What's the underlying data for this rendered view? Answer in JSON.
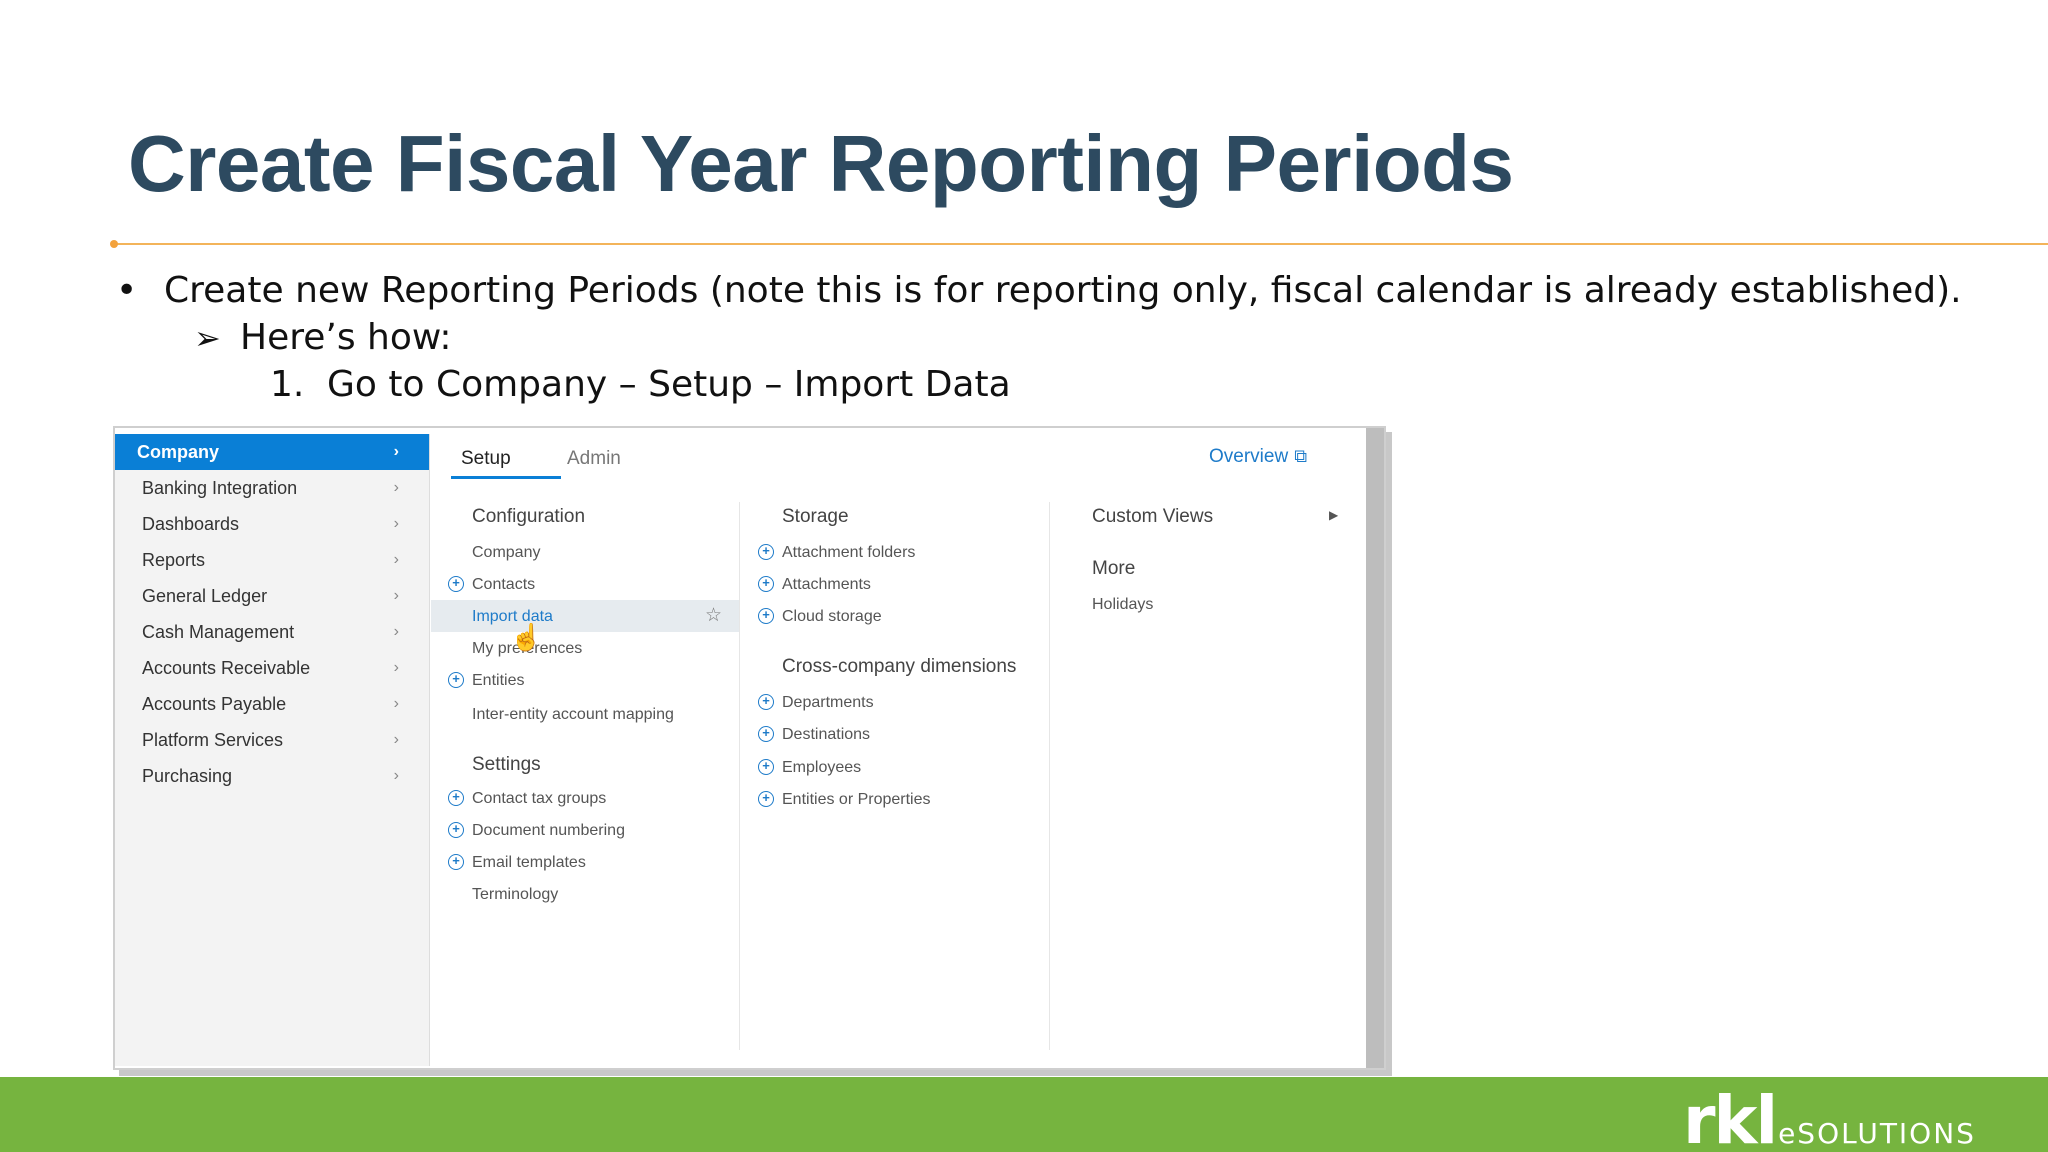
{
  "slide": {
    "title": "Create Fiscal Year Reporting Periods",
    "bullet_1": "Create new Reporting Periods (note this is for reporting only, fiscal calendar is already established).",
    "bullet_2": "Here’s how:",
    "step_1_number": "1.",
    "step_1": "Go to Company – Setup – Import Data"
  },
  "sidebar": {
    "items": [
      {
        "label": "Company"
      },
      {
        "label": "Banking Integration"
      },
      {
        "label": "Dashboards"
      },
      {
        "label": "Reports"
      },
      {
        "label": "General Ledger"
      },
      {
        "label": "Cash Management"
      },
      {
        "label": "Accounts Receivable"
      },
      {
        "label": "Accounts Payable"
      },
      {
        "label": "Platform Services"
      },
      {
        "label": "Purchasing"
      }
    ]
  },
  "tabs": {
    "setup": "Setup",
    "admin": "Admin",
    "overview": "Overview"
  },
  "configuration": {
    "title": "Configuration",
    "items": [
      "Company",
      "Contacts",
      "Import data",
      "My preferences",
      "Entities",
      "Inter-entity account mapping"
    ]
  },
  "settings": {
    "title": "Settings",
    "items": [
      "Contact tax groups",
      "Document numbering",
      "Email templates",
      "Terminology"
    ]
  },
  "storage": {
    "title": "Storage",
    "items": [
      "Attachment folders",
      "Attachments",
      "Cloud storage"
    ]
  },
  "cross_company": {
    "title": "Cross-company dimensions",
    "items": [
      "Departments",
      "Destinations",
      "Employees",
      "Entities or Properties"
    ]
  },
  "custom_views": {
    "title": "Custom Views"
  },
  "more": {
    "title": "More",
    "items": [
      "Holidays"
    ]
  },
  "logo": {
    "rkl": "rkl",
    "solutions": "eSOLUTIONS"
  },
  "colors": {
    "title": "#2d4a60",
    "accent_line": "#f3b45a",
    "active_nav": "#0a7fd6",
    "link": "#1e7bc9",
    "footer": "#76b43f"
  },
  "icons": {
    "bullet": "bullet-icon",
    "arrow": "arrow-bullet-icon",
    "chevron": "chevron-right-icon",
    "plus": "plus-circle-icon",
    "star": "star-icon",
    "external": "external-link-icon",
    "cursor": "hand-cursor-icon"
  }
}
